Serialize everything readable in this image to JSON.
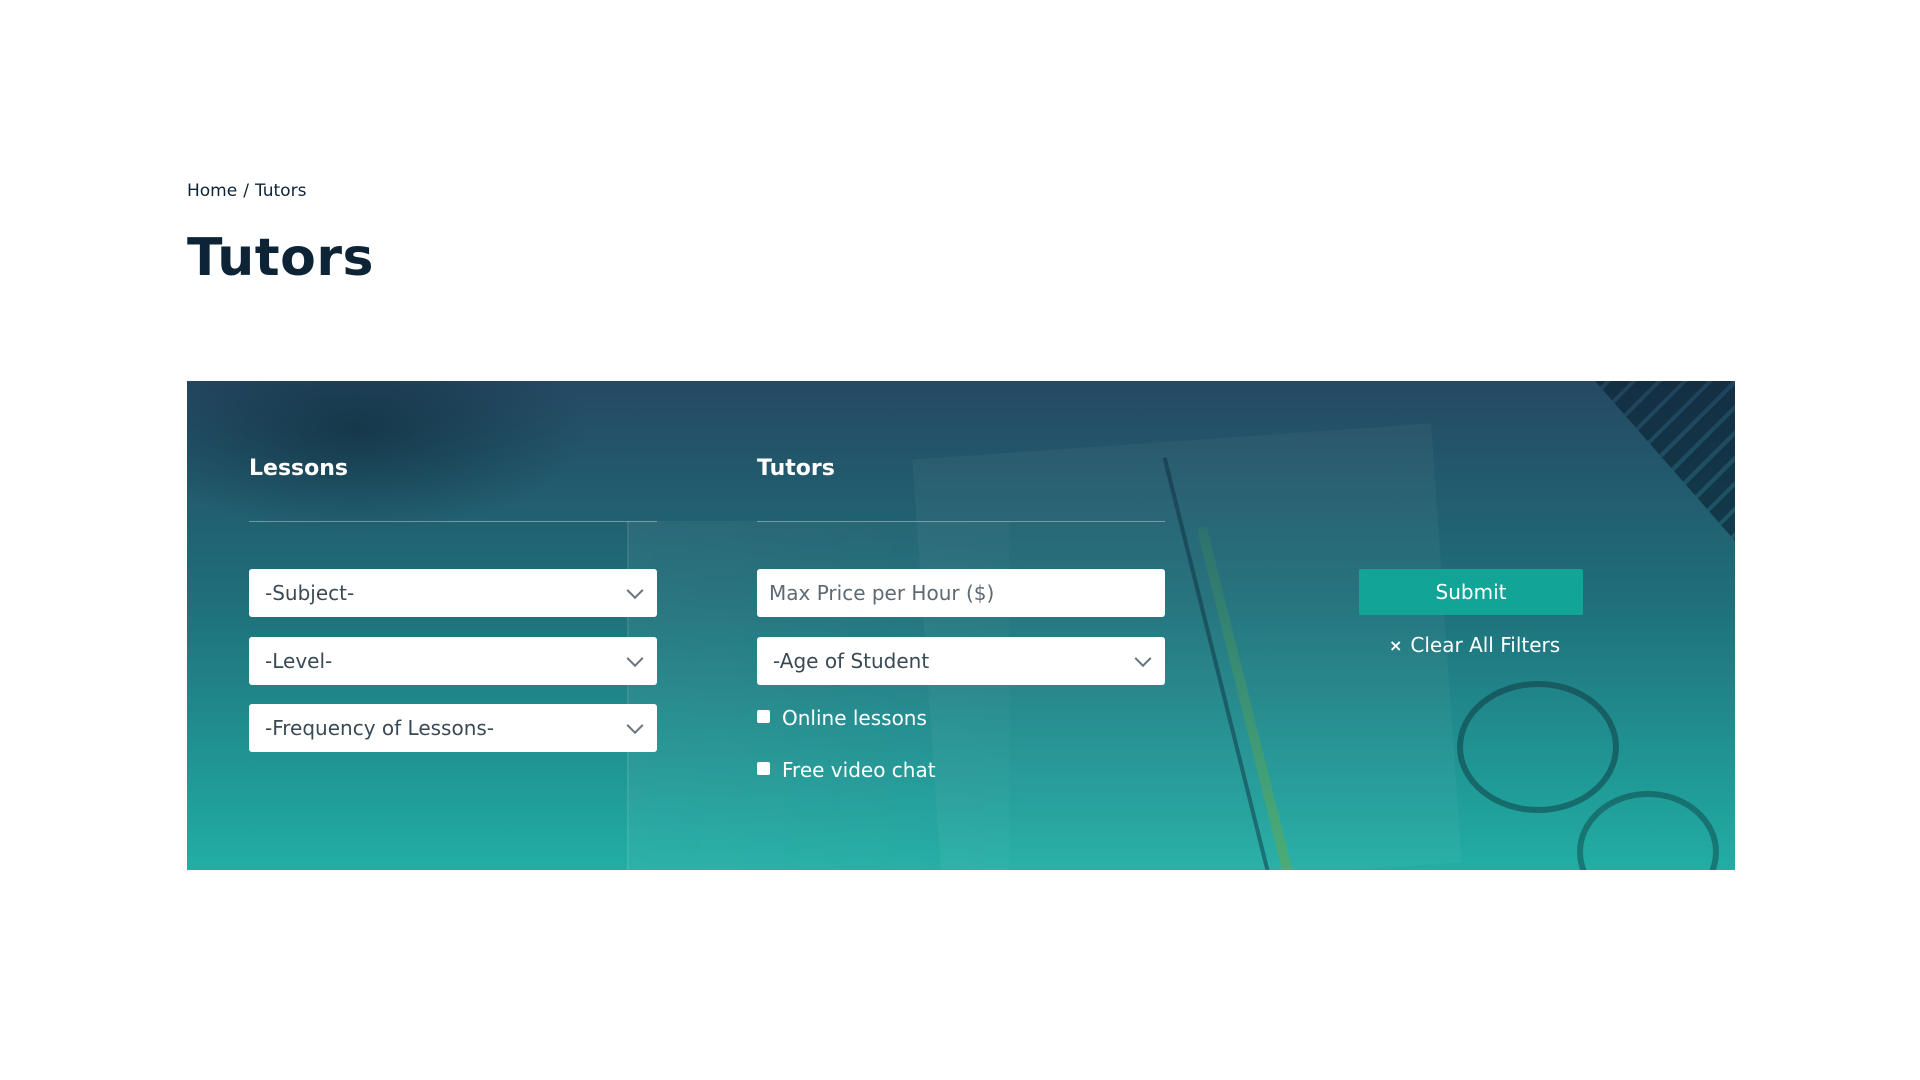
{
  "breadcrumb": {
    "home": "Home",
    "separator": "/",
    "current": "Tutors"
  },
  "page_title": "Tutors",
  "filters": {
    "lessons": {
      "title": "Lessons",
      "subject": "-Subject-",
      "level": "-Level-",
      "frequency": "-Frequency of Lessons-"
    },
    "tutors": {
      "title": "Tutors",
      "max_price_placeholder": "Max Price per Hour ($)",
      "max_price_value": "",
      "age": "-Age of Student",
      "online_lessons": "Online lessons",
      "free_video_chat": "Free video chat"
    },
    "actions": {
      "submit": "Submit",
      "clear_icon": "×",
      "clear_label": "Clear All Filters"
    }
  },
  "icons": {
    "dropdown": "chevron-down-icon",
    "clear": "close-icon"
  },
  "colors": {
    "title": "#0d2436",
    "panel_top": "#254963",
    "panel_bottom": "#21aea5",
    "submit": "#12a597"
  }
}
